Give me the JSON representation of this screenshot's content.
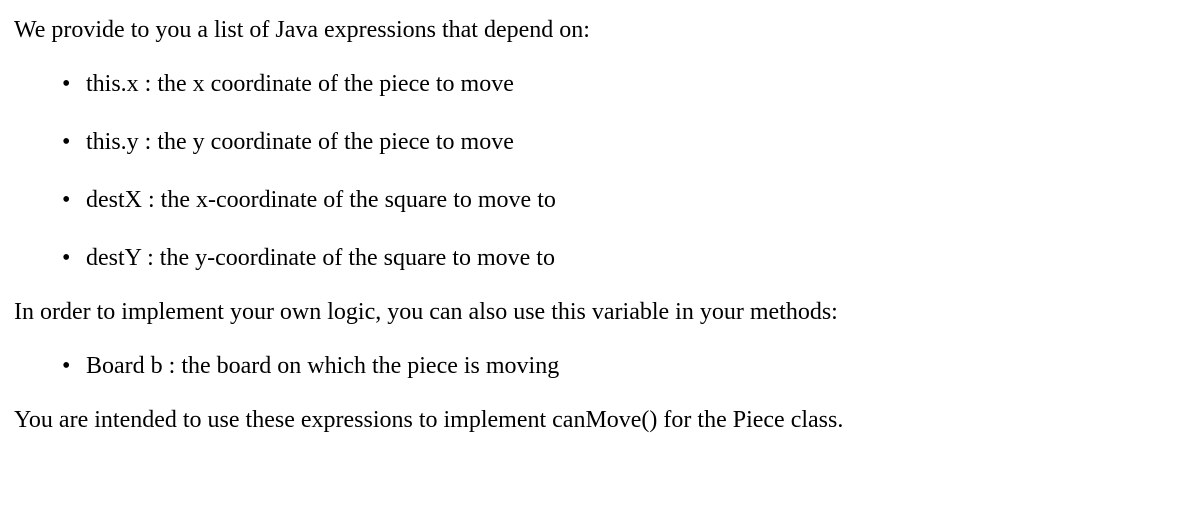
{
  "intro": "We provide to you a list of Java expressions that depend on:",
  "expressions": [
    "this.x : the x coordinate of the piece to move",
    "this.y : the y coordinate of the piece to move",
    "destX : the x-coordinate of the square to move to",
    "destY : the y-coordinate of the square to move to"
  ],
  "middle": "In order to implement your own logic, you can also use this variable in your methods:",
  "variables": [
    "Board b : the board on which the piece is moving"
  ],
  "outro": "You are intended to use these expressions to implement canMove() for the Piece class."
}
